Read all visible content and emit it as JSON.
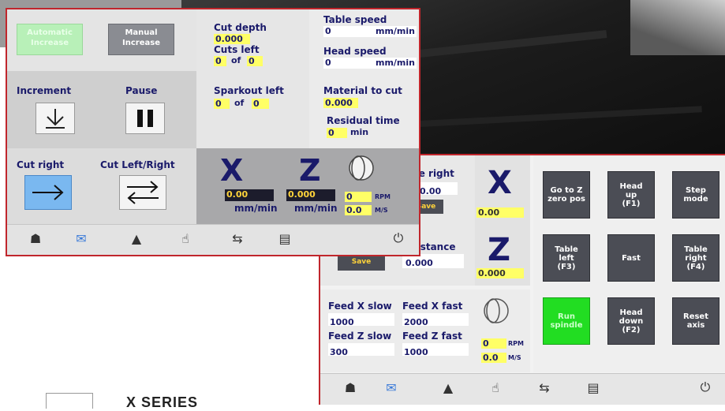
{
  "main": {
    "automatic_increase": "Automatic\nIncrease",
    "manual_increase": "Manual\nIncrease",
    "cut_depth_label": "Cut depth",
    "cut_depth_value": "0.000",
    "cuts_left_label": "Cuts left",
    "cuts_left_value": "0",
    "cuts_left_of": "of",
    "cuts_left_total": "0",
    "sparkout_left_label": "Sparkout left",
    "sparkout_value": "0",
    "sparkout_of": "of",
    "sparkout_total": "0",
    "table_speed_label": "Table speed",
    "table_speed_value": "0",
    "table_speed_unit": "mm/min",
    "head_speed_label": "Head speed",
    "head_speed_value": "0",
    "head_speed_unit": "mm/min",
    "material_label": "Material to cut",
    "material_value": "0.000",
    "residual_label": "Residual time",
    "residual_value": "0",
    "residual_unit": "min",
    "increment_label": "Increment",
    "pause_label": "Pause",
    "cut_right_label": "Cut right",
    "cut_left_right_label": "Cut Left/Right",
    "x_axis": "X",
    "z_axis": "Z",
    "x_value": "0.00",
    "z_value": "0.000",
    "x_unit": "mm/min",
    "z_unit": "mm/min",
    "rpm_value": "0",
    "rpm_unit": "RPM",
    "ms_value": "0.0",
    "ms_unit": "M/S"
  },
  "second": {
    "table_right_label": "ble right",
    "table_right_value": "0.00",
    "save_label": "Save",
    "x_axis": "X",
    "x_value": "0.00",
    "distance_label": "distance",
    "distance_value": "0.000",
    "zero_save_label": "Zero and\nSave",
    "z_axis": "Z",
    "z_value": "0.000",
    "feed_x_slow_label": "Feed X slow",
    "feed_x_slow_value": "1000",
    "feed_x_fast_label": "Feed X fast",
    "feed_x_fast_value": "2000",
    "feed_z_slow_label": "Feed Z slow",
    "feed_z_slow_value": "300",
    "feed_z_fast_label": "Feed Z fast",
    "feed_z_fast_value": "1000",
    "rpm_value": "0",
    "rpm_unit": "RPM",
    "ms_value": "0.0",
    "ms_unit": "M/S",
    "buttons": [
      "Go to Z\nzero pos",
      "Head\nup\n(F1)",
      "Step\nmode",
      "Table\nleft\n(F3)",
      "Fast",
      "Table\nright\n(F4)",
      "Run\nspindle",
      "Head\ndown\n(F2)",
      "Reset\naxis"
    ]
  },
  "footer_text": "X SERIES",
  "colors": {
    "frame": "#c0262c",
    "value_yellow": "#ffff66",
    "run_green": "#22dd22",
    "auto_green": "#b8f0b8",
    "cut_right_blue": "#7ab8f0"
  }
}
